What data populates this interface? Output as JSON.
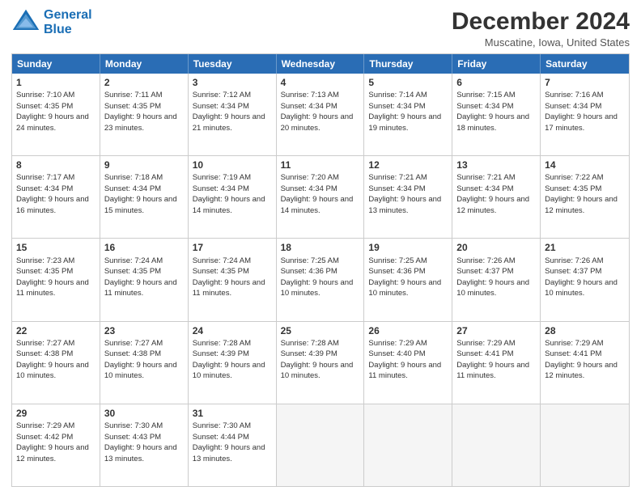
{
  "logo": {
    "line1": "General",
    "line2": "Blue"
  },
  "title": "December 2024",
  "location": "Muscatine, Iowa, United States",
  "header": {
    "days": [
      "Sunday",
      "Monday",
      "Tuesday",
      "Wednesday",
      "Thursday",
      "Friday",
      "Saturday"
    ]
  },
  "rows": [
    [
      {
        "day": "1",
        "sunrise": "7:10 AM",
        "sunset": "4:35 PM",
        "hours": "9 hours and 24 minutes."
      },
      {
        "day": "2",
        "sunrise": "7:11 AM",
        "sunset": "4:35 PM",
        "hours": "9 hours and 23 minutes."
      },
      {
        "day": "3",
        "sunrise": "7:12 AM",
        "sunset": "4:34 PM",
        "hours": "9 hours and 21 minutes."
      },
      {
        "day": "4",
        "sunrise": "7:13 AM",
        "sunset": "4:34 PM",
        "hours": "9 hours and 20 minutes."
      },
      {
        "day": "5",
        "sunrise": "7:14 AM",
        "sunset": "4:34 PM",
        "hours": "9 hours and 19 minutes."
      },
      {
        "day": "6",
        "sunrise": "7:15 AM",
        "sunset": "4:34 PM",
        "hours": "9 hours and 18 minutes."
      },
      {
        "day": "7",
        "sunrise": "7:16 AM",
        "sunset": "4:34 PM",
        "hours": "9 hours and 17 minutes."
      }
    ],
    [
      {
        "day": "8",
        "sunrise": "7:17 AM",
        "sunset": "4:34 PM",
        "hours": "9 hours and 16 minutes."
      },
      {
        "day": "9",
        "sunrise": "7:18 AM",
        "sunset": "4:34 PM",
        "hours": "9 hours and 15 minutes."
      },
      {
        "day": "10",
        "sunrise": "7:19 AM",
        "sunset": "4:34 PM",
        "hours": "9 hours and 14 minutes."
      },
      {
        "day": "11",
        "sunrise": "7:20 AM",
        "sunset": "4:34 PM",
        "hours": "9 hours and 14 minutes."
      },
      {
        "day": "12",
        "sunrise": "7:21 AM",
        "sunset": "4:34 PM",
        "hours": "9 hours and 13 minutes."
      },
      {
        "day": "13",
        "sunrise": "7:21 AM",
        "sunset": "4:34 PM",
        "hours": "9 hours and 12 minutes."
      },
      {
        "day": "14",
        "sunrise": "7:22 AM",
        "sunset": "4:35 PM",
        "hours": "9 hours and 12 minutes."
      }
    ],
    [
      {
        "day": "15",
        "sunrise": "7:23 AM",
        "sunset": "4:35 PM",
        "hours": "9 hours and 11 minutes."
      },
      {
        "day": "16",
        "sunrise": "7:24 AM",
        "sunset": "4:35 PM",
        "hours": "9 hours and 11 minutes."
      },
      {
        "day": "17",
        "sunrise": "7:24 AM",
        "sunset": "4:35 PM",
        "hours": "9 hours and 11 minutes."
      },
      {
        "day": "18",
        "sunrise": "7:25 AM",
        "sunset": "4:36 PM",
        "hours": "9 hours and 10 minutes."
      },
      {
        "day": "19",
        "sunrise": "7:25 AM",
        "sunset": "4:36 PM",
        "hours": "9 hours and 10 minutes."
      },
      {
        "day": "20",
        "sunrise": "7:26 AM",
        "sunset": "4:37 PM",
        "hours": "9 hours and 10 minutes."
      },
      {
        "day": "21",
        "sunrise": "7:26 AM",
        "sunset": "4:37 PM",
        "hours": "9 hours and 10 minutes."
      }
    ],
    [
      {
        "day": "22",
        "sunrise": "7:27 AM",
        "sunset": "4:38 PM",
        "hours": "9 hours and 10 minutes."
      },
      {
        "day": "23",
        "sunrise": "7:27 AM",
        "sunset": "4:38 PM",
        "hours": "9 hours and 10 minutes."
      },
      {
        "day": "24",
        "sunrise": "7:28 AM",
        "sunset": "4:39 PM",
        "hours": "9 hours and 10 minutes."
      },
      {
        "day": "25",
        "sunrise": "7:28 AM",
        "sunset": "4:39 PM",
        "hours": "9 hours and 10 minutes."
      },
      {
        "day": "26",
        "sunrise": "7:29 AM",
        "sunset": "4:40 PM",
        "hours": "9 hours and 11 minutes."
      },
      {
        "day": "27",
        "sunrise": "7:29 AM",
        "sunset": "4:41 PM",
        "hours": "9 hours and 11 minutes."
      },
      {
        "day": "28",
        "sunrise": "7:29 AM",
        "sunset": "4:41 PM",
        "hours": "9 hours and 12 minutes."
      }
    ],
    [
      {
        "day": "29",
        "sunrise": "7:29 AM",
        "sunset": "4:42 PM",
        "hours": "9 hours and 12 minutes."
      },
      {
        "day": "30",
        "sunrise": "7:30 AM",
        "sunset": "4:43 PM",
        "hours": "9 hours and 13 minutes."
      },
      {
        "day": "31",
        "sunrise": "7:30 AM",
        "sunset": "4:44 PM",
        "hours": "9 hours and 13 minutes."
      },
      null,
      null,
      null,
      null
    ]
  ]
}
